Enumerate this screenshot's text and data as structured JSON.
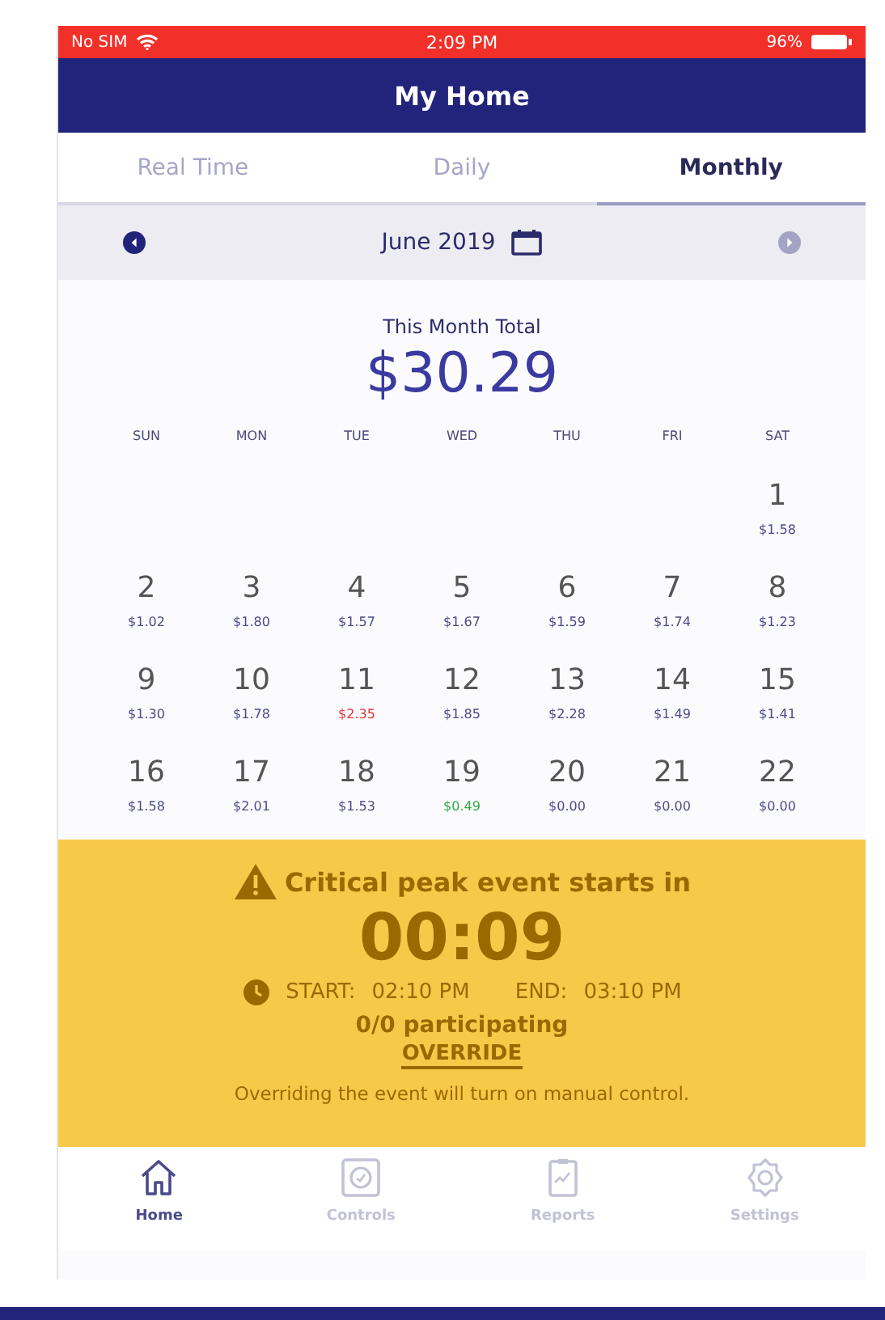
{
  "status_bar": {
    "carrier": "No SIM",
    "time": "2:09 PM",
    "battery": "96%"
  },
  "header": {
    "title": "My Home"
  },
  "tabs": [
    {
      "label": "Real Time",
      "selected": false
    },
    {
      "label": "Daily",
      "selected": false
    },
    {
      "label": "Monthly",
      "selected": true
    }
  ],
  "month_bar": {
    "label": "June 2019",
    "prev_disabled": false,
    "next_disabled": true
  },
  "total": {
    "label": "This Month Total",
    "amount": "$30.29"
  },
  "calendar": {
    "weekdays": [
      "SUN",
      "MON",
      "TUE",
      "WED",
      "THU",
      "FRI",
      "SAT"
    ],
    "weeks": [
      [
        {
          "kind": "blank"
        },
        {
          "kind": "blank"
        },
        {
          "kind": "blank"
        },
        {
          "kind": "blank"
        },
        {
          "kind": "blank"
        },
        {
          "kind": "blank"
        },
        {
          "kind": "day",
          "day": "1",
          "amount": "$1.58",
          "color": "#4a4a8a"
        }
      ],
      [
        {
          "kind": "day",
          "day": "2",
          "amount": "$1.02",
          "color": "#4a4a8a"
        },
        {
          "kind": "day",
          "day": "3",
          "amount": "$1.80",
          "color": "#4a4a8a"
        },
        {
          "kind": "day",
          "day": "4",
          "amount": "$1.57",
          "color": "#4a4a8a"
        },
        {
          "kind": "day",
          "day": "5",
          "amount": "$1.67",
          "color": "#4a4a8a"
        },
        {
          "kind": "day",
          "day": "6",
          "amount": "$1.59",
          "color": "#4a4a8a"
        },
        {
          "kind": "day",
          "day": "7",
          "amount": "$1.74",
          "color": "#4a4a8a"
        },
        {
          "kind": "day",
          "day": "8",
          "amount": "$1.23",
          "color": "#4a4a8a"
        }
      ],
      [
        {
          "kind": "day",
          "day": "9",
          "amount": "$1.30",
          "color": "#4a4a8a"
        },
        {
          "kind": "day",
          "day": "10",
          "amount": "$1.78",
          "color": "#4a4a8a"
        },
        {
          "kind": "day",
          "day": "11",
          "amount": "$2.35",
          "color": "#e0333a"
        },
        {
          "kind": "day",
          "day": "12",
          "amount": "$1.85",
          "color": "#4a4a8a"
        },
        {
          "kind": "day",
          "day": "13",
          "amount": "$2.28",
          "color": "#4a4a8a"
        },
        {
          "kind": "day",
          "day": "14",
          "amount": "$1.49",
          "color": "#4a4a8a"
        },
        {
          "kind": "day",
          "day": "15",
          "amount": "$1.41",
          "color": "#4a4a8a"
        }
      ],
      [
        {
          "kind": "day",
          "day": "16",
          "amount": "$1.58",
          "color": "#4a4a8a"
        },
        {
          "kind": "day",
          "day": "17",
          "amount": "$2.01",
          "color": "#4a4a8a"
        },
        {
          "kind": "day",
          "day": "18",
          "amount": "$1.53",
          "color": "#4a4a8a"
        },
        {
          "kind": "day",
          "day": "19",
          "amount": "$0.49",
          "color": "#2fa84a"
        },
        {
          "kind": "day",
          "day": "20",
          "amount": "$0.00",
          "color": "#4a4a8a"
        },
        {
          "kind": "day",
          "day": "21",
          "amount": "$0.00",
          "color": "#4a4a8a"
        },
        {
          "kind": "day",
          "day": "22",
          "amount": "$0.00",
          "color": "#4a4a8a"
        }
      ]
    ]
  },
  "event_banner": {
    "title": "Critical peak event starts in",
    "countdown": "00:09",
    "start_label": "START:",
    "start_time": "02:10 PM",
    "end_label": "END:",
    "end_time": "03:10 PM",
    "participating": "0/0 participating",
    "override": "OVERRIDE",
    "note": "Overriding the event will turn on manual control."
  },
  "bottom_nav": [
    {
      "label": "Home",
      "kind": "home",
      "selected": true
    },
    {
      "label": "Controls",
      "kind": "controls",
      "selected": false
    },
    {
      "label": "Reports",
      "kind": "reports",
      "selected": false
    },
    {
      "label": "Settings",
      "kind": "settings",
      "selected": false
    }
  ]
}
